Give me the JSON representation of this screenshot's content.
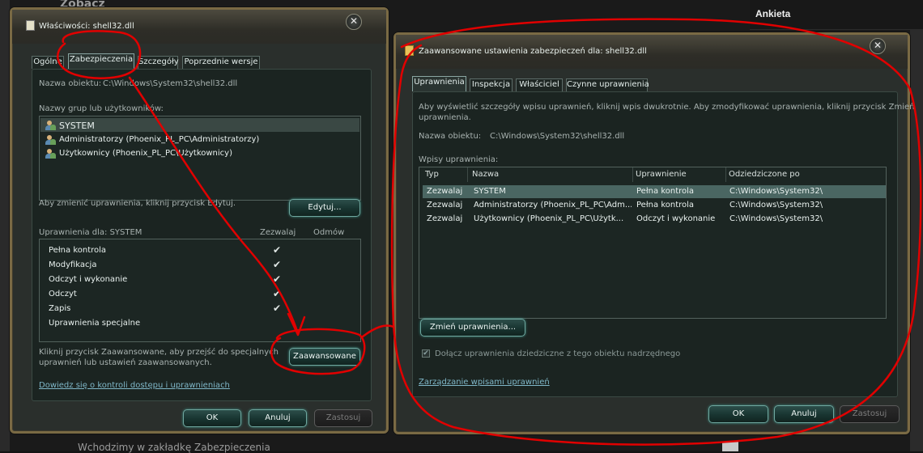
{
  "background": {
    "top_text": "Zobacz",
    "ankieta": "Ankieta",
    "bottom_text": "Wchodzimy w zakładkę Zabezpieczenia"
  },
  "props": {
    "title": "Właściwości: shell32.dll",
    "tabs": [
      "Ogólne",
      "Zabezpieczenia",
      "Szczegóły",
      "Poprzednie wersje"
    ],
    "object_label": "Nazwa obiektu:",
    "object_value": "C:\\Windows\\System32\\shell32.dll",
    "groups_label": "Nazwy grup lub użytkowników:",
    "groups": [
      "SYSTEM",
      "Administratorzy (Phoenix_PL_PC\\Administratorzy)",
      "Użytkownicy (Phoenix_PL_PC\\Użytkownicy)"
    ],
    "edit_hint": "Aby zmienić uprawnienia, kliknij przycisk Edytuj.",
    "edit_button": "Edytuj...",
    "perm_label": "Uprawnienia dla: SYSTEM",
    "allow_header": "Zezwalaj",
    "deny_header": "Odmów",
    "permissions": [
      {
        "name": "Pełna kontrola",
        "allow": "✔"
      },
      {
        "name": "Modyfikacja",
        "allow": "✔"
      },
      {
        "name": "Odczyt i wykonanie",
        "allow": "✔"
      },
      {
        "name": "Odczyt",
        "allow": "✔"
      },
      {
        "name": "Zapis",
        "allow": "✔"
      },
      {
        "name": "Uprawnienia specjalne",
        "allow": ""
      }
    ],
    "advanced_hint_1": "Kliknij przycisk Zaawansowane, aby przejść do specjalnych",
    "advanced_hint_2": "uprawnień lub ustawień zaawansowanych.",
    "advanced_button": "Zaawansowane",
    "learn_link": "Dowiedz się o kontroli dostępu i uprawnieniach",
    "ok": "OK",
    "cancel": "Anuluj",
    "apply": "Zastosuj"
  },
  "advanced": {
    "title": "Zaawansowane ustawienia zabezpieczeń dla: shell32.dll",
    "tabs": [
      "Uprawnienia",
      "Inspekcja",
      "Właściciel",
      "Czynne uprawnienia"
    ],
    "info_1": "Aby wyświetlić szczegóły wpisu uprawnień, kliknij wpis dwukrotnie. Aby zmodyfikować uprawnienia, kliknij przycisk Zmień",
    "info_2": "uprawnienia.",
    "object_label": "Nazwa obiektu:",
    "object_value": "C:\\Windows\\System32\\shell32.dll",
    "entries_label": "Wpisy uprawnienia:",
    "columns": [
      "Typ",
      "Nazwa",
      "Uprawnienie",
      "Odziedziczone po"
    ],
    "rows": [
      [
        "Zezwalaj",
        "SYSTEM",
        "Pełna kontrola",
        "C:\\Windows\\System32\\"
      ],
      [
        "Zezwalaj",
        "Administratorzy (Phoenix_PL_PC\\Adm...",
        "Pełna kontrola",
        "C:\\Windows\\System32\\"
      ],
      [
        "Zezwalaj",
        "Użytkownicy (Phoenix_PL_PC\\Użytk...",
        "Odczyt i wykonanie",
        "C:\\Windows\\System32\\"
      ]
    ],
    "change_button": "Zmień uprawnienia...",
    "include_inherited": "Dołącz uprawnienia dziedziczne z tego obiektu nadrzędnego",
    "include_checked": "✔",
    "manage_link": "Zarządzanie wpisami uprawnień",
    "ok": "OK",
    "cancel": "Anuluj",
    "apply": "Zastosuj"
  },
  "annotation_color": "#e10000"
}
